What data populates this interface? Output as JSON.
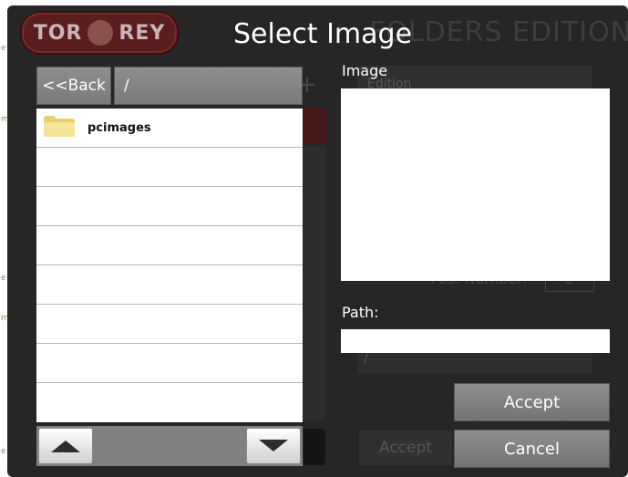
{
  "background": {
    "logo_left": "TOR",
    "logo_right": "REY",
    "title": "FOLDERS EDITION",
    "edition_field": "Edition",
    "pos_number_label": "Pos. Number:",
    "pos_number_value": "2",
    "path_value": "/",
    "accept_label": "Accept"
  },
  "dialog": {
    "title": "Select Image",
    "back_label": "<<Back",
    "current_path": "/",
    "files": [
      {
        "name": "pcimages",
        "type": "folder"
      },
      {
        "name": "",
        "type": "empty"
      },
      {
        "name": "",
        "type": "empty"
      },
      {
        "name": "",
        "type": "empty"
      },
      {
        "name": "",
        "type": "empty"
      },
      {
        "name": "",
        "type": "empty"
      },
      {
        "name": "",
        "type": "empty"
      },
      {
        "name": "",
        "type": "empty"
      }
    ],
    "image_label": "Image",
    "path_label": "Path:",
    "path_value": "",
    "accept_label": "Accept",
    "cancel_label": "Cancel"
  },
  "icons": {
    "folder": "folder-icon",
    "scroll_up": "triangle-up-icon",
    "scroll_down": "triangle-down-icon"
  },
  "colors": {
    "frame": "#262626",
    "button": "#808080",
    "folder": "#f3dc8a",
    "logo": "#5a1e1e"
  }
}
